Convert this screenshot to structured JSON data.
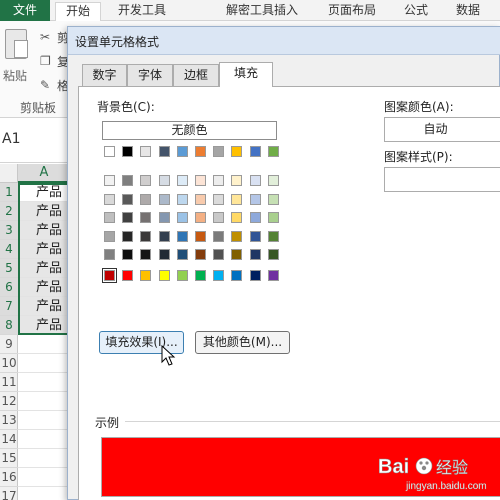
{
  "ribbon": {
    "tabs": [
      "文件",
      "开始",
      "开发工具",
      "解密工具",
      "插入",
      "页面布局",
      "公式",
      "数据"
    ],
    "paste_label": "粘贴",
    "cut_label": "剪",
    "copy_label": "复",
    "format_label": "格",
    "clipboard_group": "剪贴板"
  },
  "name_box": "A1",
  "sheet": {
    "column": "A",
    "rows": [
      "1",
      "2",
      "3",
      "4",
      "5",
      "6",
      "7",
      "8",
      "9",
      "10",
      "11",
      "12",
      "13",
      "14",
      "15",
      "16",
      "17"
    ],
    "cells": [
      "产品",
      "产品",
      "产品",
      "产品",
      "产品",
      "产品",
      "产品",
      "产品"
    ]
  },
  "dialog": {
    "title": "设置单元格格式",
    "tabs": [
      "数字",
      "字体",
      "边框",
      "填充"
    ],
    "active_tab": "填充",
    "background_color_label": "背景色(C):",
    "no_color_button": "无颜色",
    "fill_effects_button": "填充效果(I)...",
    "more_colors_button": "其他颜色(M)...",
    "pattern_color_label": "图案颜色(A):",
    "pattern_color_value": "自动",
    "pattern_style_label": "图案样式(P):",
    "sample_label": "示例",
    "sample_color": "#FF0000",
    "selected_color": "#C00000"
  },
  "palette": {
    "theme_top": [
      "#FFFFFF",
      "#000000",
      "#E7E6E6",
      "#44546A",
      "#5B9BD5",
      "#ED7D31",
      "#A5A5A5",
      "#FFC000",
      "#4472C4",
      "#70AD47"
    ],
    "theme_shades": [
      [
        "#F2F2F2",
        "#7F7F7F",
        "#D0CECE",
        "#D6DCE4",
        "#DDEBF7",
        "#FCE4D6",
        "#EDEDED",
        "#FFF2CC",
        "#D9E1F2",
        "#E2EFDA"
      ],
      [
        "#D9D9D9",
        "#595959",
        "#AEAAAA",
        "#ACB9CA",
        "#BDD7EE",
        "#F8CBAD",
        "#DBDBDB",
        "#FFE699",
        "#B4C6E7",
        "#C6E0B4"
      ],
      [
        "#BFBFBF",
        "#404040",
        "#757171",
        "#8497B0",
        "#9BC2E6",
        "#F4B084",
        "#C9C9C9",
        "#FFD966",
        "#8EA9DB",
        "#A9D08E"
      ],
      [
        "#A6A6A6",
        "#262626",
        "#3A3838",
        "#333F4F",
        "#2F75B5",
        "#C65911",
        "#7B7B7B",
        "#BF8F00",
        "#305496",
        "#548235"
      ],
      [
        "#808080",
        "#0D0D0D",
        "#161616",
        "#222B35",
        "#1F4E78",
        "#833C0C",
        "#525252",
        "#806000",
        "#203764",
        "#375623"
      ]
    ],
    "standard": [
      "#C00000",
      "#FF0000",
      "#FFC000",
      "#FFFF00",
      "#92D050",
      "#00B050",
      "#00B0F0",
      "#0070C0",
      "#002060",
      "#7030A0"
    ]
  },
  "watermark": {
    "text": "Bai",
    "text2": "经验",
    "url": "jingyan.baidu.com"
  }
}
